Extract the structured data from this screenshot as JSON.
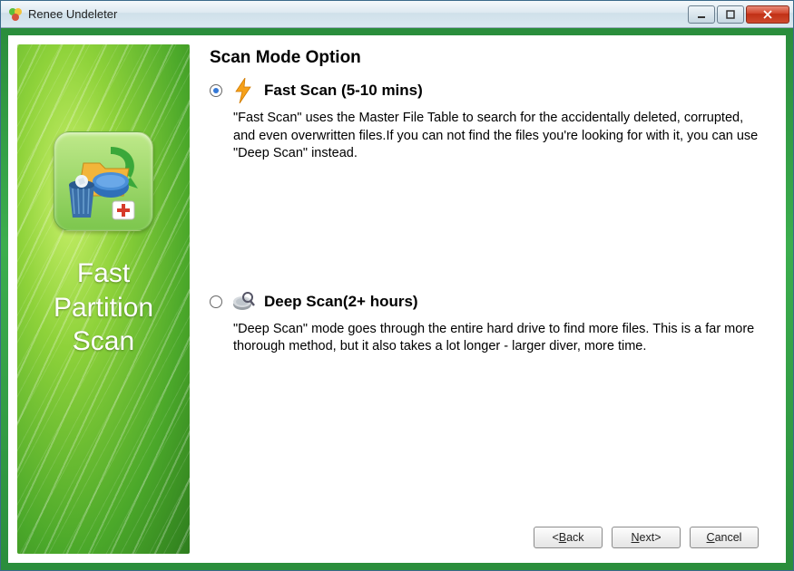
{
  "window": {
    "title": "Renee Undeleter"
  },
  "sidebar": {
    "title": "Fast\nPartition\nScan"
  },
  "main": {
    "heading": "Scan Mode Option",
    "options": [
      {
        "label": "Fast Scan (5-10 mins)",
        "description": "\"Fast Scan\" uses the Master File Table to search for the accidentally deleted, corrupted, and even overwritten files.If you can not find the files you're looking for with it, you can use \"Deep Scan\" instead.",
        "selected": true
      },
      {
        "label": "Deep Scan(2+ hours)",
        "description": "\"Deep Scan\" mode goes through the entire hard drive to find more files. This is a far more thorough method, but it also takes a lot longer - larger diver, more time.",
        "selected": false
      }
    ]
  },
  "footer": {
    "back": "<Back",
    "next": "Next>",
    "cancel": "Cancel"
  }
}
